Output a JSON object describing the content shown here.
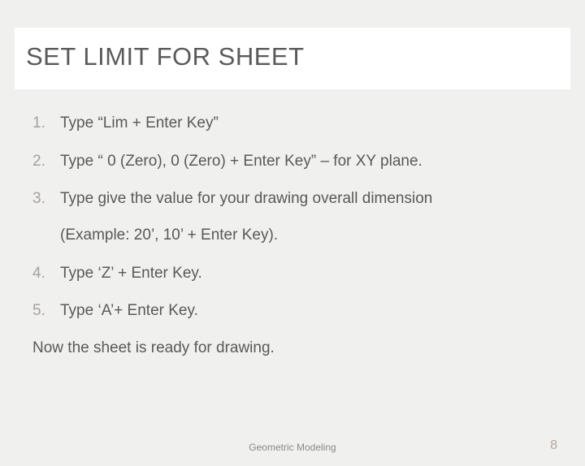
{
  "title": "SET LIMIT FOR SHEET",
  "steps": [
    {
      "text": "Type “Lim + Enter Key”"
    },
    {
      "text": "Type “ 0 (Zero), 0 (Zero) + Enter Key” – for XY plane."
    },
    {
      "text": "Type give the value for your drawing overall dimension",
      "sub": "(Example: 20’, 10’ + Enter Key)."
    },
    {
      "text": "Type ‘Z’ + Enter Key."
    },
    {
      "text": "Type ‘A’+ Enter Key."
    }
  ],
  "closing": "Now the sheet is ready for drawing.",
  "footer_label": "Geometric Modeling",
  "page_number": "8"
}
